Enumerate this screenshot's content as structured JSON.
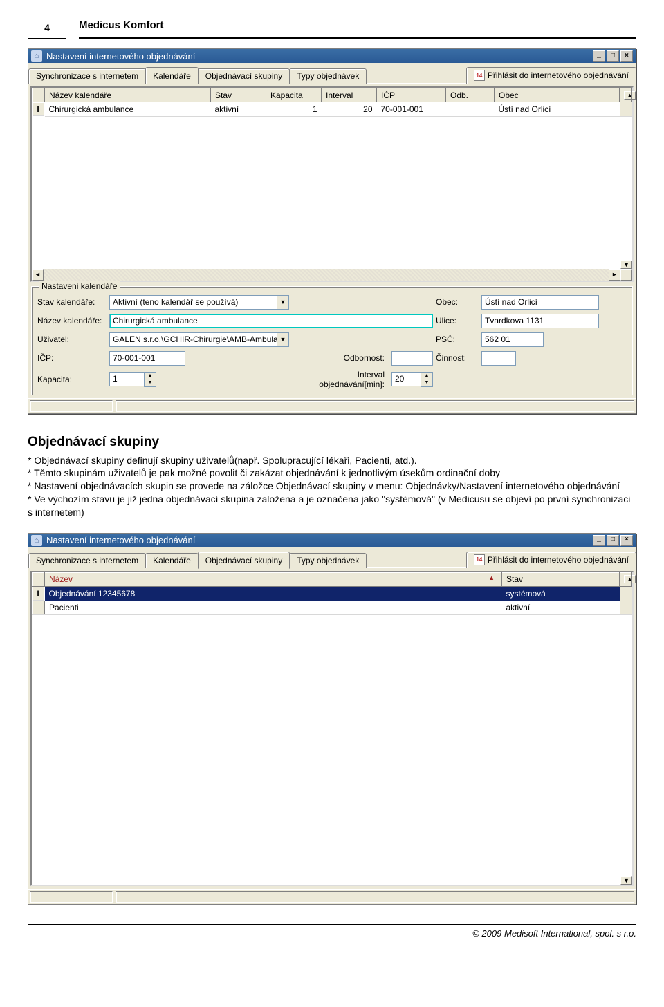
{
  "header": {
    "page_number": "4",
    "doc_title": "Medicus Komfort"
  },
  "win1": {
    "title": "Nastavení internetového objednávání",
    "tabs": [
      "Synchronizace s internetem",
      "Kalendáře",
      "Objednávací skupiny",
      "Typy objednávek"
    ],
    "active_tab_index": 1,
    "right_tab": "Přihlásit do internetového objednávání",
    "columns": [
      "Název kalendáře",
      "Stav",
      "Kapacita",
      "Interval",
      "IČP",
      "Odb.",
      "Obec"
    ],
    "row": {
      "nazev": "Chirurgická ambulance",
      "stav": "aktivní",
      "kapacita": "1",
      "interval": "20",
      "icp": "70-001-001",
      "odb": "",
      "obec": "Ústí nad Orlicí"
    },
    "group": {
      "legend": "Nastaveni kalendáře",
      "labels": {
        "stav": "Stav kalendáře:",
        "nazev": "Název kalendáře:",
        "uzivatel": "Uživatel:",
        "icp": "IČP:",
        "kapacita": "Kapacita:",
        "odbornost": "Odbornost:",
        "interval": "Interval objednávání[min]:",
        "obec": "Obec:",
        "ulice": "Ulice:",
        "psc": "PSČ:",
        "cinnost": "Činnost:"
      },
      "values": {
        "stav": "Aktivní (teno kalendář se používá)",
        "nazev": "Chirurgická ambulance",
        "uzivatel": "GALEN s.r.o.\\GCHIR-Chirurgie\\AMB-Ambulance\\MIC",
        "icp": "70-001-001",
        "kapacita": "1",
        "odbornost": "",
        "interval": "20",
        "obec": "Ústí nad Orlicí",
        "ulice": "Tvardkova 1131",
        "psc": "562 01",
        "cinnost": ""
      }
    }
  },
  "section": {
    "title": "Objednávací skupiny",
    "lines": [
      "* Objednávací skupiny definují skupiny uživatelů(např. Spolupracující lékaři, Pacienti, atd.).",
      "* Těmto skupinám uživatelů je pak možné povolit či zakázat objednávání k jednotlivým úsekům ordinační doby",
      "* Nastavení objednávacích skupin se provede na záložce Objednávací skupiny v menu: Objednávky/Nastavení internetového objednávání",
      "* Ve výchozím stavu je již jedna objednávací skupina založena a je označena jako \"systémová\" (v Medicusu se objeví po první synchronizaci s internetem)"
    ]
  },
  "win2": {
    "title": "Nastavení internetového objednávání",
    "tabs": [
      "Synchronizace s internetem",
      "Kalendáře",
      "Objednávací skupiny",
      "Typy objednávek"
    ],
    "active_tab_index": 2,
    "right_tab": "Přihlásit do internetového objednávání",
    "columns": [
      "Název",
      "Stav"
    ],
    "rows": [
      {
        "nazev": "Objednávání 12345678",
        "stav": "systémová"
      },
      {
        "nazev": "Pacienti",
        "stav": "aktivní"
      }
    ]
  },
  "footer": "© 2009 Medisoft International, spol. s r.o."
}
